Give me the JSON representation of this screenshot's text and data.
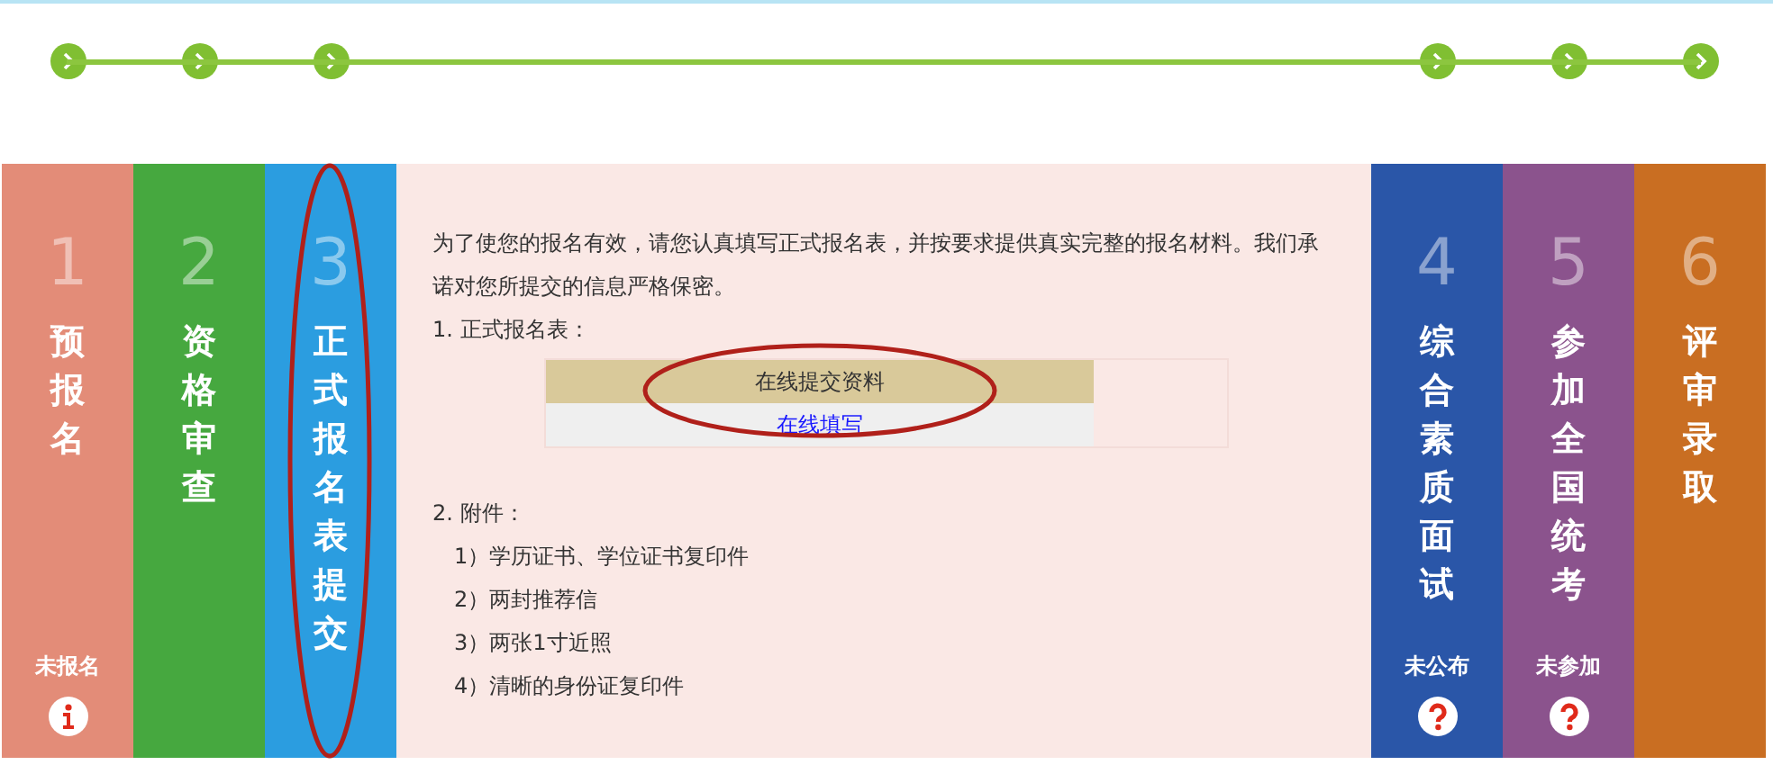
{
  "steps": [
    {
      "number": "1",
      "title": "预报名",
      "status": "未报名",
      "kind": "info",
      "color": "#e38c78",
      "selected": false
    },
    {
      "number": "2",
      "title": "资格审查",
      "color": "#46a83f",
      "selected": false
    },
    {
      "number": "3",
      "title": "正式报名表提交",
      "color": "#2b9de0",
      "selected": true
    },
    {
      "number": "4",
      "title": "综合素质面试",
      "status": "未公布",
      "kind": "question",
      "color": "#2a56a8",
      "selected": false
    },
    {
      "number": "5",
      "title": "参加全国统考",
      "status": "未参加",
      "kind": "question",
      "color": "#8b538d",
      "selected": false
    },
    {
      "number": "6",
      "title": "评审录取",
      "color": "#c96e22",
      "selected": false
    }
  ],
  "panel": {
    "intro": "为了使您的报名有效，请您认真填写正式报名表，并按要求提供真实完整的报名材料。我们承诺对您所提交的信息严格保密。",
    "form_heading": "1. 正式报名表：",
    "form_table": {
      "header": "在线提交资料",
      "link": "在线填写"
    },
    "attachments_heading": "2. 附件：",
    "attachments": [
      "1）学历证书、学位证书复印件",
      "2）两封推荐信",
      "3）两张1寸近照",
      "4）清晰的身份证复印件"
    ]
  }
}
